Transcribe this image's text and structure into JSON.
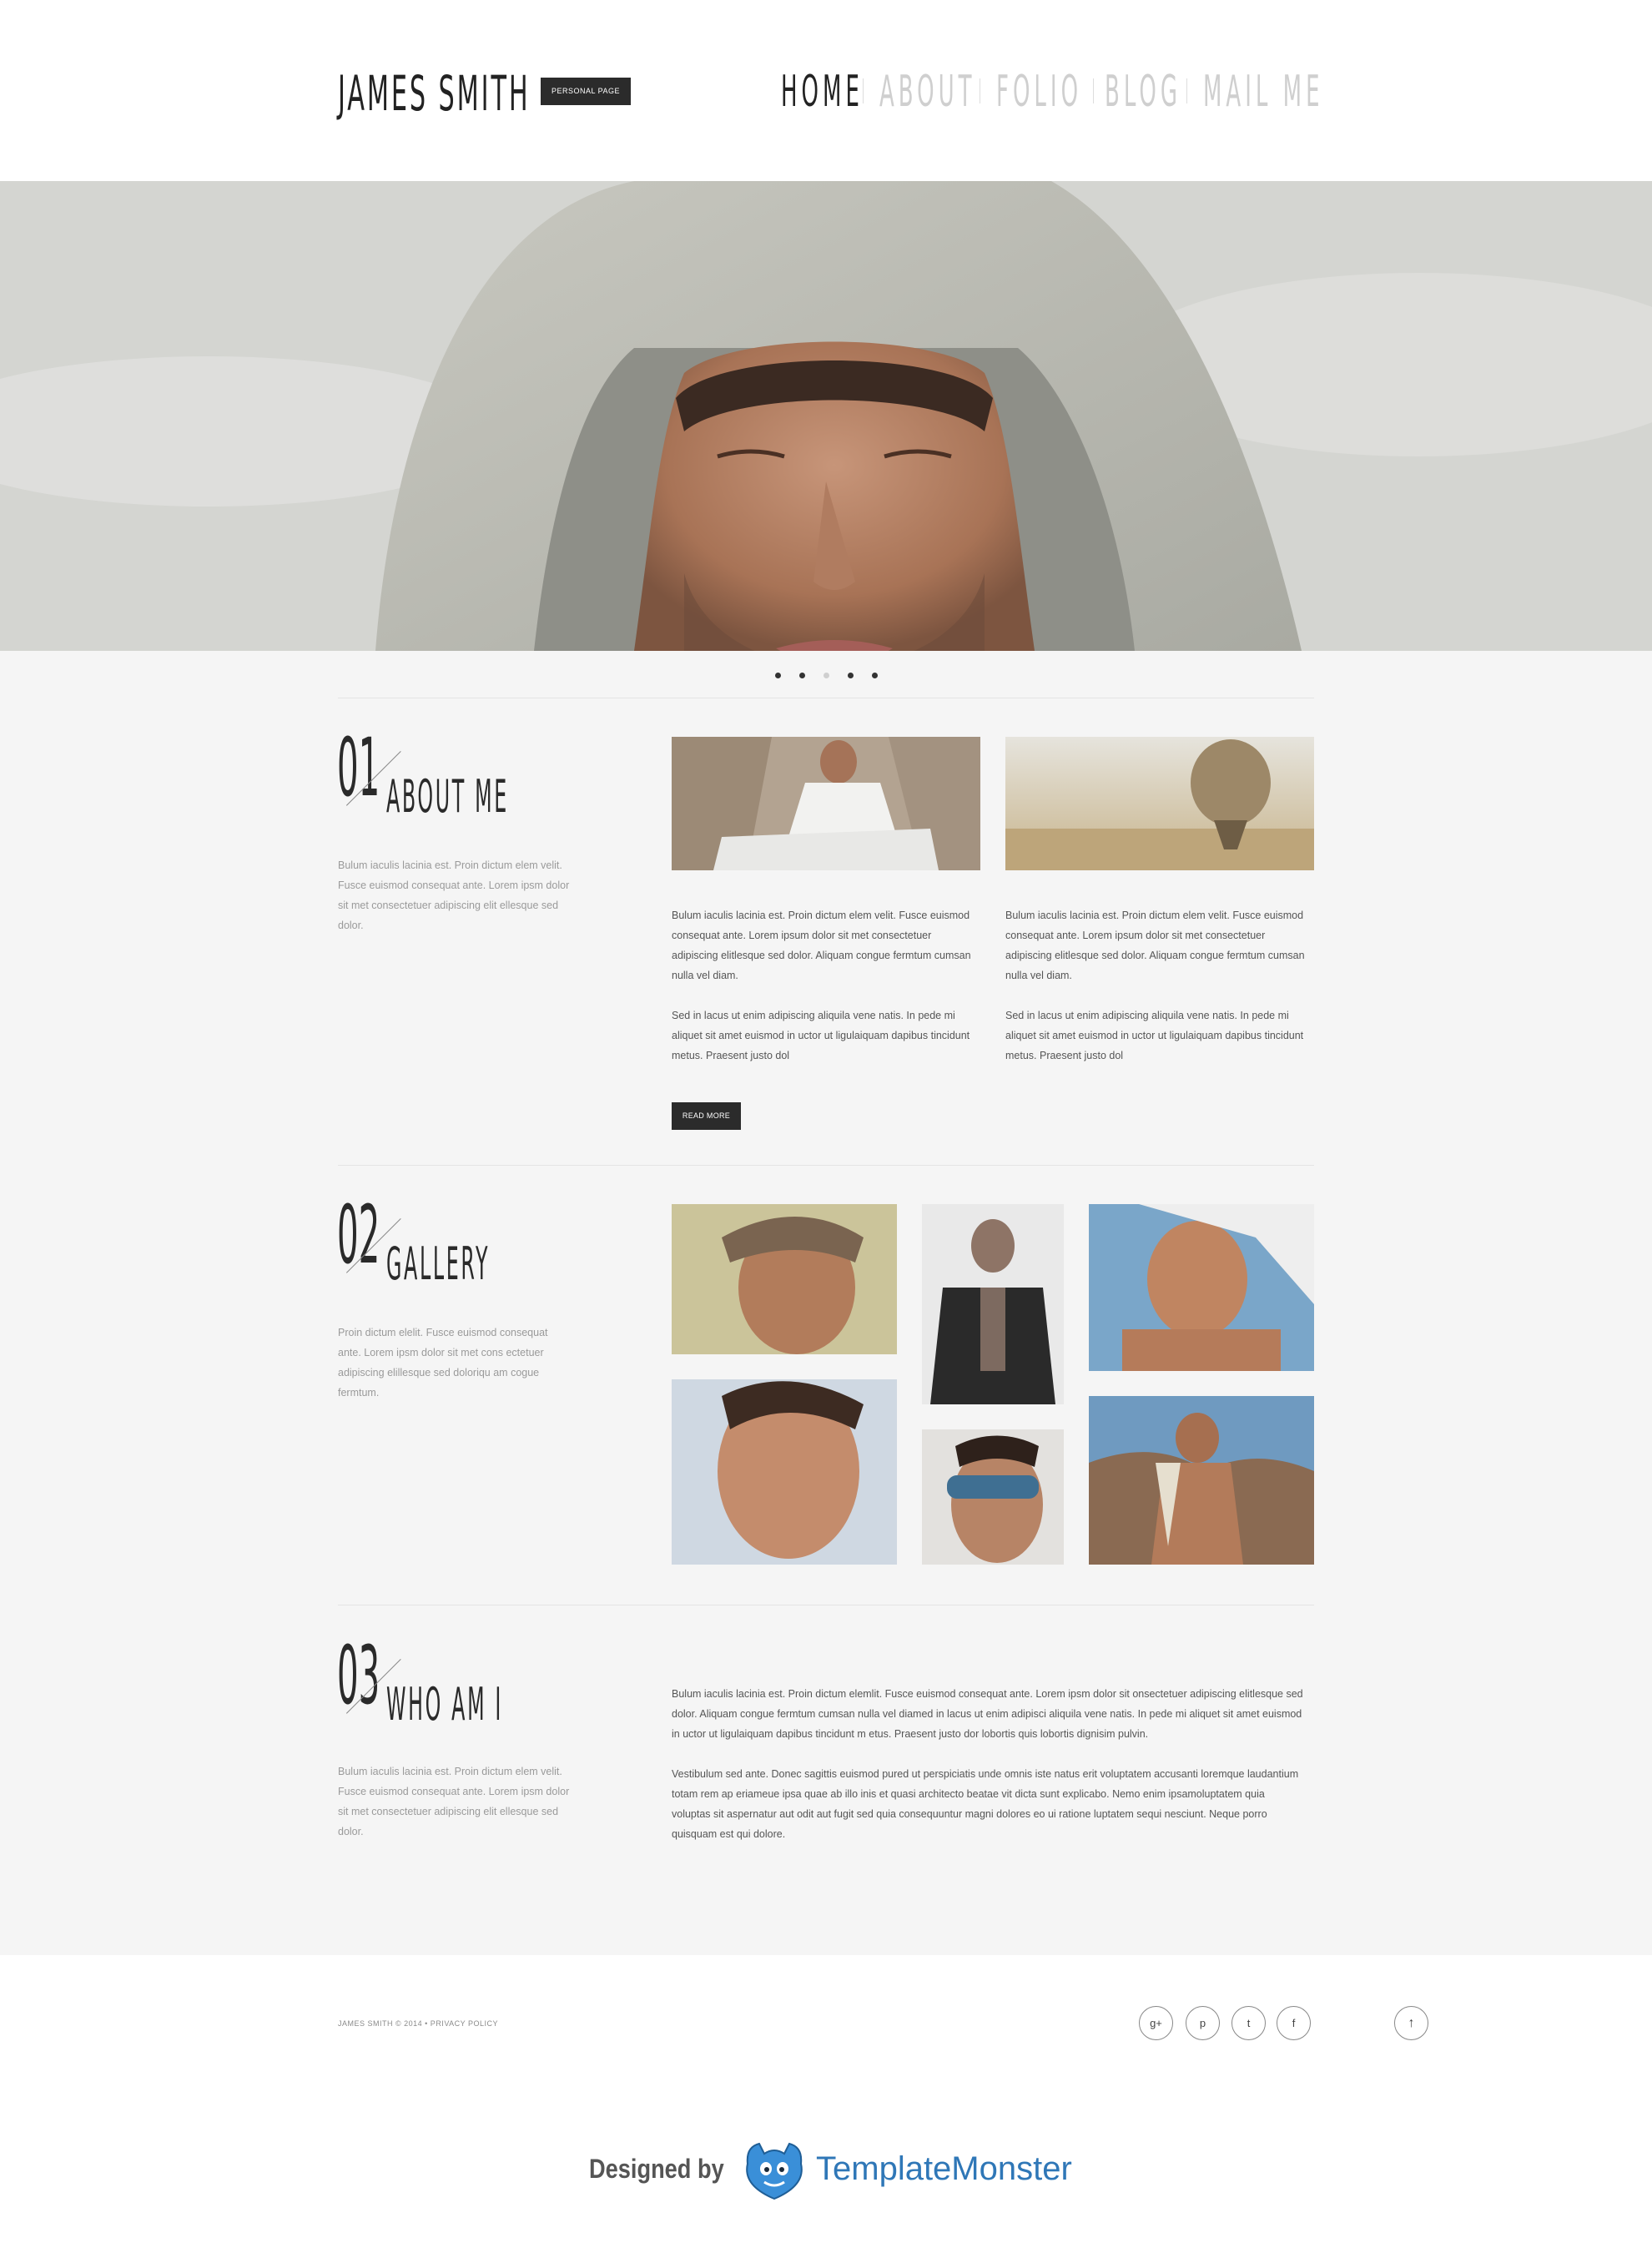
{
  "header": {
    "logo": "JAMES SMITH",
    "badge": "PERSONAL PAGE",
    "nav": [
      "HOME",
      "ABOUT",
      "FOLIO",
      "BLOG",
      "MAIL ME"
    ]
  },
  "slider": {
    "dots": 5,
    "active_index": 2
  },
  "about": {
    "number": "01",
    "title": "ABOUT ME",
    "side_text": "Bulum iaculis lacinia est. Proin dictum elem velit. Fusce euismod consequat ante. Lorem ipsm dolor sit met consectetuer adipiscing elit ellesque sed dolor.",
    "col1_p1": "Bulum iaculis lacinia est. Proin dictum elem velit. Fusce euismod consequat ante. Lorem ipsum dolor sit met consectetuer adipiscing elitlesque sed dolor. Aliquam congue fermtum cumsan nulla vel diam.",
    "col1_p2": "Sed in lacus ut enim adipiscing aliquila vene natis. In pede mi aliquet sit amet euismod in uctor ut ligulaiquam dapibus tincidunt metus. Praesent justo dol",
    "col2_p1": "Bulum iaculis lacinia est. Proin dictum elem velit. Fusce euismod consequat ante. Lorem ipsum dolor sit met consectetuer adipiscing elitlesque sed dolor. Aliquam congue fermtum cumsan nulla vel diam.",
    "col2_p2": "Sed in lacus ut enim adipiscing aliquila vene natis. In pede mi aliquet sit amet euismod in uctor ut ligulaiquam dapibus tincidunt metus. Praesent justo dol",
    "button": "READ MORE"
  },
  "gallery": {
    "number": "02",
    "title": "GALLERY",
    "side_text": "Proin dictum elelit. Fusce euismod consequat ante. Lorem ipsm dolor sit met cons ectetuer adipiscing elillesque sed doloriqu am cogue fermtum."
  },
  "who": {
    "number": "03",
    "title": "WHO AM I",
    "side_text": "Bulum iaculis lacinia est. Proin dictum elem velit. Fusce euismod consequat ante. Lorem ipsm dolor sit met consectetuer adipiscing elit ellesque sed dolor.",
    "p1": "Bulum iaculis lacinia est. Proin dictum elemlit. Fusce euismod consequat ante. Lorem ipsm dolor sit onsectetuer adipiscing elitlesque sed dolor. Aliquam congue fermtum cumsan nulla vel diamed in lacus ut enim adipisci aliquila vene natis. In pede mi aliquet sit amet euismod in uctor ut ligulaiquam dapibus tincidunt m etus. Praesent justo dor lobortis quis lobortis dignisim pulvin.",
    "p2": "Vestibulum sed ante. Donec sagittis euismod pured ut perspiciatis unde omnis iste natus erit voluptatem accusanti loremque laudantium totam rem ap eriameue ipsa quae ab illo inis et quasi architecto beatae vit dicta sunt explicabo. Nemo enim ipsamoluptatem quia voluptas sit aspernatur aut odit aut fugit sed quia consequuntur magni dolores eo ui ratione luptatem sequi nesciunt. Neque porro quisquam est qui dolore."
  },
  "footer": {
    "copyright": "JAMES SMITH © 2014 • PRIVACY POLICY",
    "social": [
      "google-plus-icon",
      "pinterest-icon",
      "twitter-icon",
      "facebook-icon"
    ],
    "social_glyphs": [
      "g+",
      "p",
      "t",
      "f"
    ],
    "to_top_glyph": "↑"
  },
  "credit": {
    "designed_by": "Designed by",
    "brand": "TemplateMonster"
  },
  "colors": {
    "dark": "#2b2b2b",
    "muted": "#cfcfcf",
    "brand": "#2f77b7",
    "background": "#f5f5f5"
  }
}
